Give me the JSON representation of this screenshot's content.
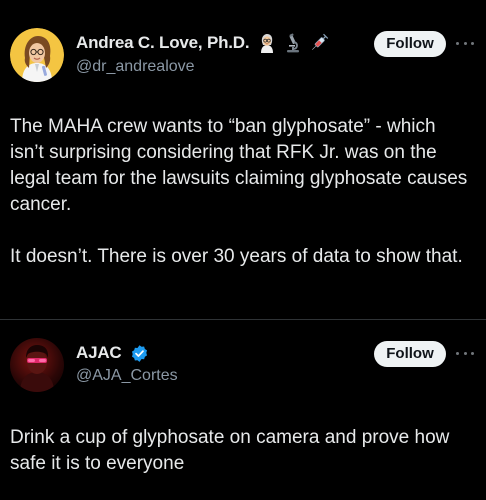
{
  "posts": [
    {
      "display_name": "Andrea C. Love, Ph.D.",
      "handle": "@dr_andrealove",
      "badges": [
        "scientist-emoji-icon",
        "microscope-emoji-icon",
        "syringe-emoji-icon"
      ],
      "follow_label": "Follow",
      "paragraphs": [
        "The MAHA crew wants to “ban glyphosate” - which isn’t surprising considering that RFK Jr. was on the legal team for the lawsuits claiming glyphosate causes cancer.",
        "It doesn’t. There is over 30 years of data to show that."
      ]
    },
    {
      "display_name": "AJAC",
      "handle": "@AJA_Cortes",
      "badges": [
        "verified-badge-icon"
      ],
      "follow_label": "Follow",
      "paragraphs": [
        "Drink a cup of glyphosate on camera and prove how safe it is to everyone"
      ]
    }
  ],
  "colors": {
    "background": "#000000",
    "text": "#e7e9ea",
    "secondary_text": "#8b98a5",
    "verified_blue": "#1d9bf0",
    "button_bg": "#eff3f4",
    "divider": "#2f3336"
  }
}
